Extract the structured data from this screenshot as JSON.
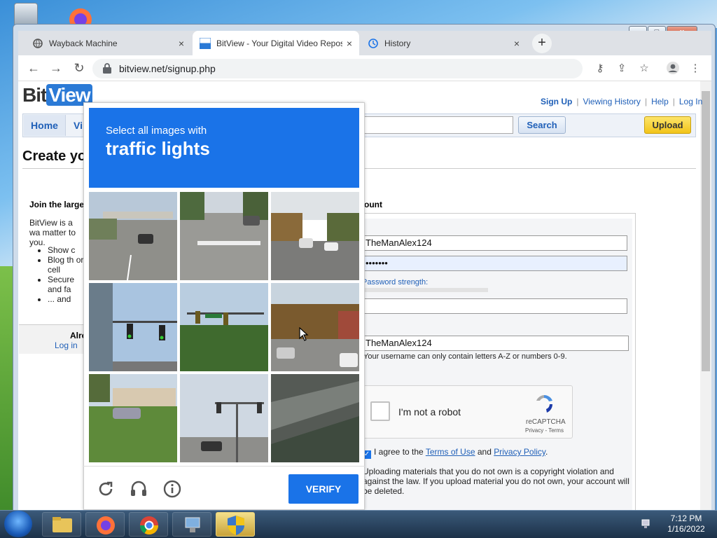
{
  "desktop": {
    "icons": [
      "recycle-bin",
      "firefox"
    ]
  },
  "window": {
    "controls": {
      "minimize": "–",
      "maximize": "□",
      "close": "x"
    }
  },
  "tabs": [
    {
      "title": "Wayback Machine",
      "icon": "wayback-icon",
      "close": "×",
      "active": false
    },
    {
      "title": "BitView - Your Digital Video Repository",
      "icon": "bitview-favicon",
      "close": "×",
      "active": true
    },
    {
      "title": "History",
      "icon": "history-icon",
      "close": "×",
      "active": false
    }
  ],
  "toolbar": {
    "url": "bitview.net/signup.php",
    "new_tab": "+",
    "back": "←",
    "forward": "→",
    "reload": "↻"
  },
  "site": {
    "logo_bit": "Bit",
    "logo_view": "View",
    "top_links": {
      "signup": "Sign Up",
      "history": "Viewing History",
      "help": "Help",
      "login": "Log In",
      "sep": "|"
    },
    "nav": {
      "home": "Home",
      "videos": "Vi",
      "search": "Search",
      "upload": "Upload"
    },
    "page_title": "Create yo",
    "join_title": "Join the large",
    "intro": "BitView is a wa matter to you.",
    "bullets": [
      "Show c",
      "Blog th or cell",
      "Secure and fa",
      "... and"
    ],
    "already": "Alre",
    "login_link": "Log in",
    "account_title": "ount",
    "form": {
      "username_value": "TheManAlex124",
      "password_mask": "•••••••",
      "password_strength": "Password strength:",
      "confirm_value": "",
      "username2_value": "TheManAlex124",
      "username_hint": "Your username can only contain letters A-Z or numbers 0-9.",
      "agree_prefix": "I agree to the",
      "terms": "Terms of Use",
      "and": "and",
      "privacy": "Privacy Policy",
      "agree_suffix": ".",
      "warning": "Uploading materials that you do not own is a copyright violation and against the law. If you upload material you do not own, your account will be deleted."
    },
    "recaptcha": {
      "label": "I'm not a robot",
      "name": "reCAPTCHA",
      "terms": "Privacy - Terms"
    }
  },
  "captcha": {
    "line1": "Select all images with",
    "line2": "traffic lights",
    "verify": "VERIFY",
    "tiles": [
      "highway-overpass",
      "city-road-crosswalk",
      "wooded-highway",
      "traffic-lights-building",
      "traffic-light-trees",
      "residential-street",
      "parking-lot-car",
      "street-traffic-light",
      "overpass-rail"
    ]
  },
  "taskbar": {
    "time": "7:12 PM",
    "date": "1/16/2022",
    "apps": [
      "file-explorer",
      "firefox",
      "chrome",
      "network-app",
      "uac-shield"
    ]
  }
}
